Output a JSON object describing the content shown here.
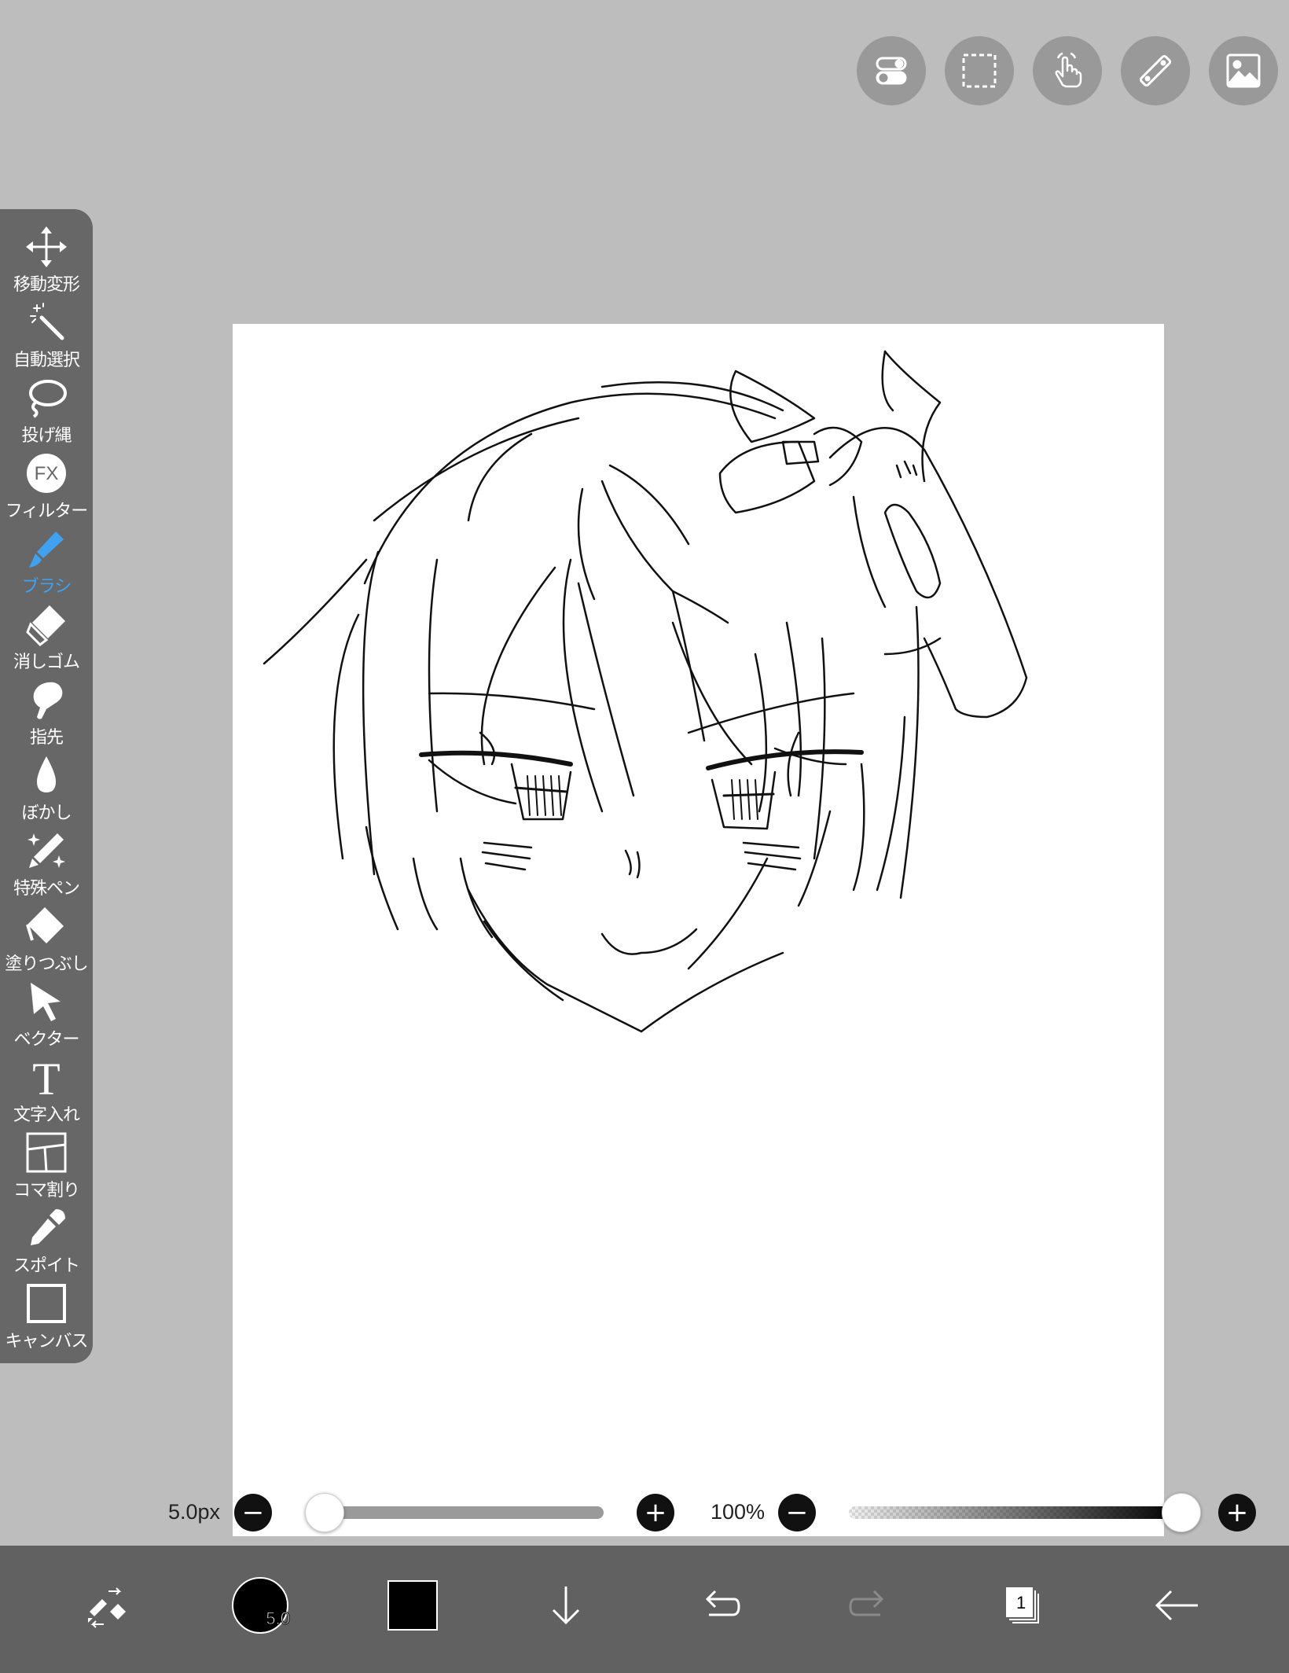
{
  "top_buttons": [
    {
      "name": "toggle-icon"
    },
    {
      "name": "selection-icon"
    },
    {
      "name": "touch-icon"
    },
    {
      "name": "ruler-icon"
    },
    {
      "name": "image-icon"
    }
  ],
  "toolbar": {
    "items": [
      {
        "label": "移動変形",
        "icon": "move-icon"
      },
      {
        "label": "自動選択",
        "icon": "magic-wand-icon"
      },
      {
        "label": "投げ縄",
        "icon": "lasso-icon"
      },
      {
        "label": "フィルター",
        "icon": "fx-icon"
      },
      {
        "label": "ブラシ",
        "icon": "brush-icon",
        "active": true
      },
      {
        "label": "消しゴム",
        "icon": "eraser-icon"
      },
      {
        "label": "指先",
        "icon": "finger-icon"
      },
      {
        "label": "ぼかし",
        "icon": "blur-icon"
      },
      {
        "label": "特殊ペン",
        "icon": "special-pen-icon"
      },
      {
        "label": "塗りつぶし",
        "icon": "fill-icon"
      },
      {
        "label": "ベクター",
        "icon": "vector-icon"
      },
      {
        "label": "文字入れ",
        "icon": "text-icon"
      },
      {
        "label": "コマ割り",
        "icon": "frame-divider-icon"
      },
      {
        "label": "スポイト",
        "icon": "eyedropper-icon"
      },
      {
        "label": "キャンバス",
        "icon": "canvas-icon"
      }
    ],
    "fx_text": "FX",
    "text_glyph": "T"
  },
  "sliders": {
    "size_label": "5.0px",
    "size_value": 5.0,
    "opacity_label": "100%",
    "opacity_value": 100,
    "minus": "−",
    "plus": "+"
  },
  "bottom_bar": {
    "brush_size_badge": "5.0",
    "layer_count": "1",
    "primary_color": "#000000"
  },
  "colors": {
    "accent": "#3fa1f0",
    "toolbar_bg": "#676767",
    "bottom_bar_bg": "#616161",
    "background": "#bdbdbd"
  }
}
